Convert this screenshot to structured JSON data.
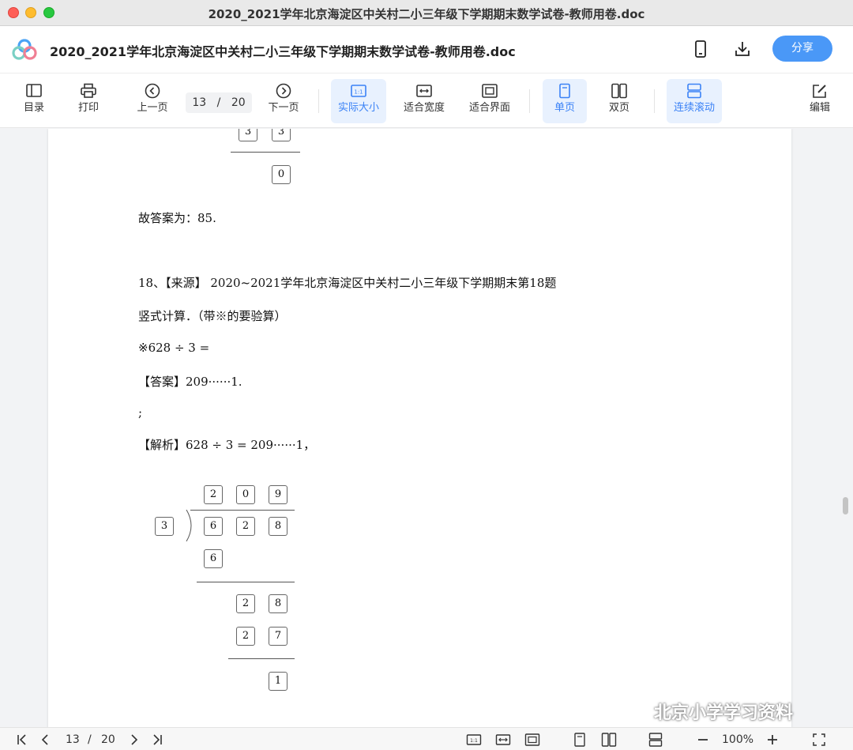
{
  "window": {
    "title": "2020_2021学年北京海淀区中关村二小三年级下学期期末数学试卷-教师用卷.doc"
  },
  "header": {
    "doc_title": "2020_2021学年北京海淀区中关村二小三年级下学期期末数学试卷-教师用卷.doc",
    "share_label": "分享",
    "phone_icon": "phone-icon",
    "download_icon": "download-icon"
  },
  "toolbar": {
    "toc_label": "目录",
    "print_label": "打印",
    "prev_label": "上一页",
    "page_current": "13",
    "page_sep": "/",
    "page_total": "20",
    "next_label": "下一页",
    "actual_size_label": "实际大小",
    "fit_width_label": "适合宽度",
    "fit_screen_label": "适合界面",
    "single_page_label": "单页",
    "double_page_label": "双页",
    "continuous_label": "连续滚动",
    "edit_label": "编辑",
    "accent_color": "#3b82f6"
  },
  "document": {
    "top_remainder_boxes": [
      "3",
      "3"
    ],
    "top_zero_box": "0",
    "answer_prev": "故答案为：85.",
    "q18_source": "18、【来源】 2020~2021学年北京海淀区中关村二小三年级下学期期末第18题",
    "q18_instruction": "竖式计算．（带※的要验算）",
    "q18_problem": "※628 ÷ 3 =",
    "q18_answer": "【答案】209······1.",
    "q18_semicolon": ";",
    "q18_analysis": "【解析】628 ÷ 3 = 209······1，",
    "division": {
      "quotient": [
        "2",
        "0",
        "9"
      ],
      "divisor": "3",
      "dividend": [
        "6",
        "2",
        "8"
      ],
      "step1": "6",
      "step2": [
        "2",
        "8"
      ],
      "step3": [
        "2",
        "7"
      ],
      "remainder": "1"
    }
  },
  "watermark": "北京小学学习资料",
  "statusbar": {
    "page_current": "13",
    "page_sep": "/",
    "page_total": "20",
    "zoom": "100%"
  }
}
